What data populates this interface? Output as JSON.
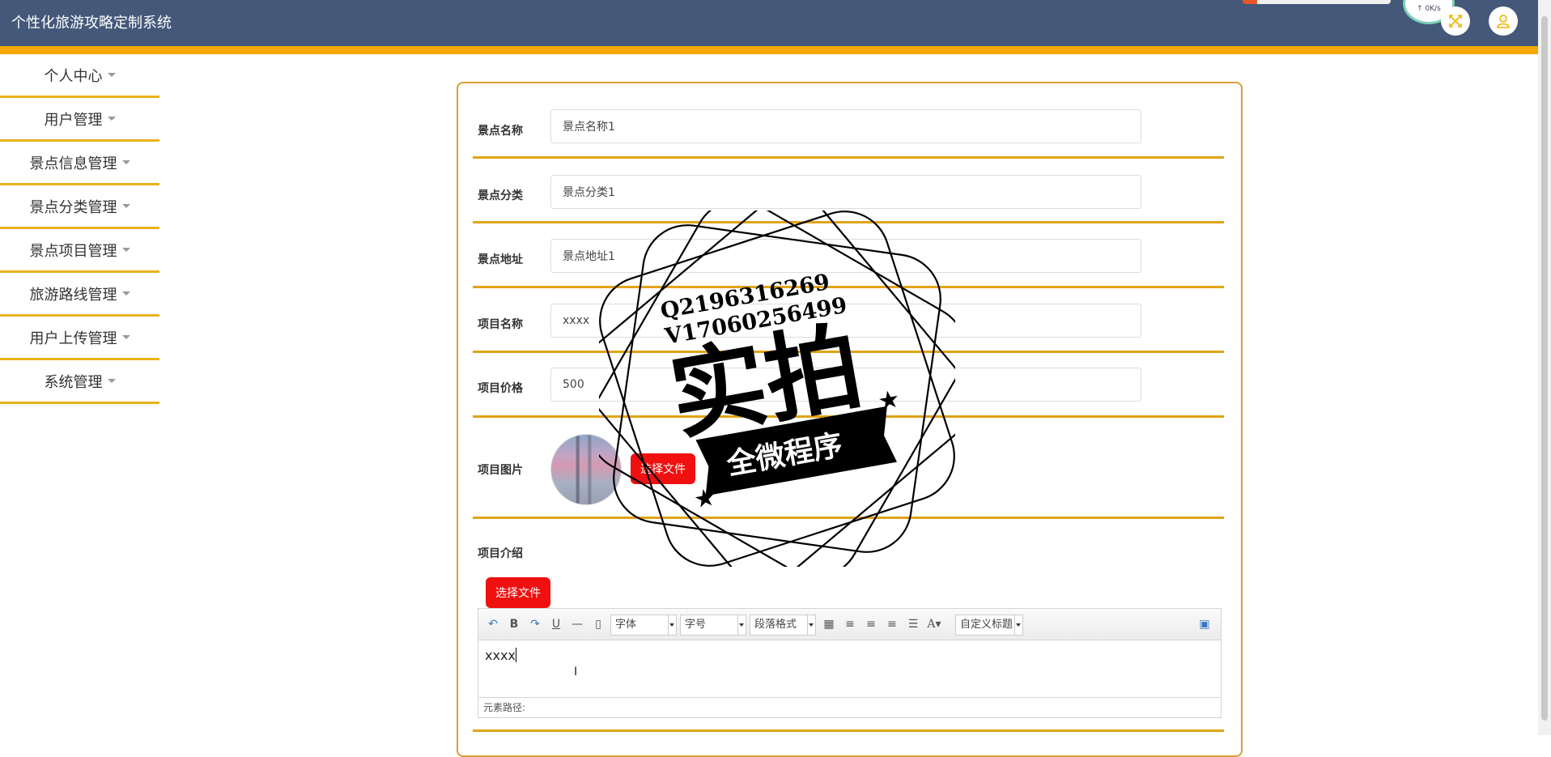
{
  "app": {
    "title": "个性化旅游攻略定制系统",
    "network_speed": "↑ 0K/s"
  },
  "colors": {
    "header_bg": "#445879",
    "accent_strip": "#f5a800",
    "file_button": "#f01010"
  },
  "header": {
    "icons": [
      "fullscreen-icon",
      "user-icon"
    ]
  },
  "sidebar": {
    "items": [
      {
        "label": "个人中心"
      },
      {
        "label": "用户管理"
      },
      {
        "label": "景点信息管理"
      },
      {
        "label": "景点分类管理"
      },
      {
        "label": "景点项目管理"
      },
      {
        "label": "旅游路线管理"
      },
      {
        "label": "用户上传管理"
      },
      {
        "label": "系统管理"
      }
    ]
  },
  "form": {
    "spot_name": {
      "label": "景点名称",
      "value": "景点名称1"
    },
    "spot_category": {
      "label": "景点分类",
      "value": "景点分类1"
    },
    "spot_address": {
      "label": "景点地址",
      "value": "景点地址1"
    },
    "project_name": {
      "label": "项目名称",
      "value": "xxxx"
    },
    "project_price": {
      "label": "项目价格",
      "value": "500"
    },
    "project_image": {
      "label": "项目图片",
      "button": "选择文件"
    },
    "project_intro": {
      "label": "项目介绍",
      "button": "选择文件"
    }
  },
  "editor": {
    "toolbar": {
      "font_family": "字体",
      "font_size": "字号",
      "paragraph": "段落格式",
      "custom_title": "自定义标题"
    },
    "content": "xxxx",
    "footer": "元素路径:"
  },
  "watermark": {
    "line1": "Q2196316269",
    "line2": "V17060256499",
    "main": "实拍",
    "banner": "全微程序"
  }
}
